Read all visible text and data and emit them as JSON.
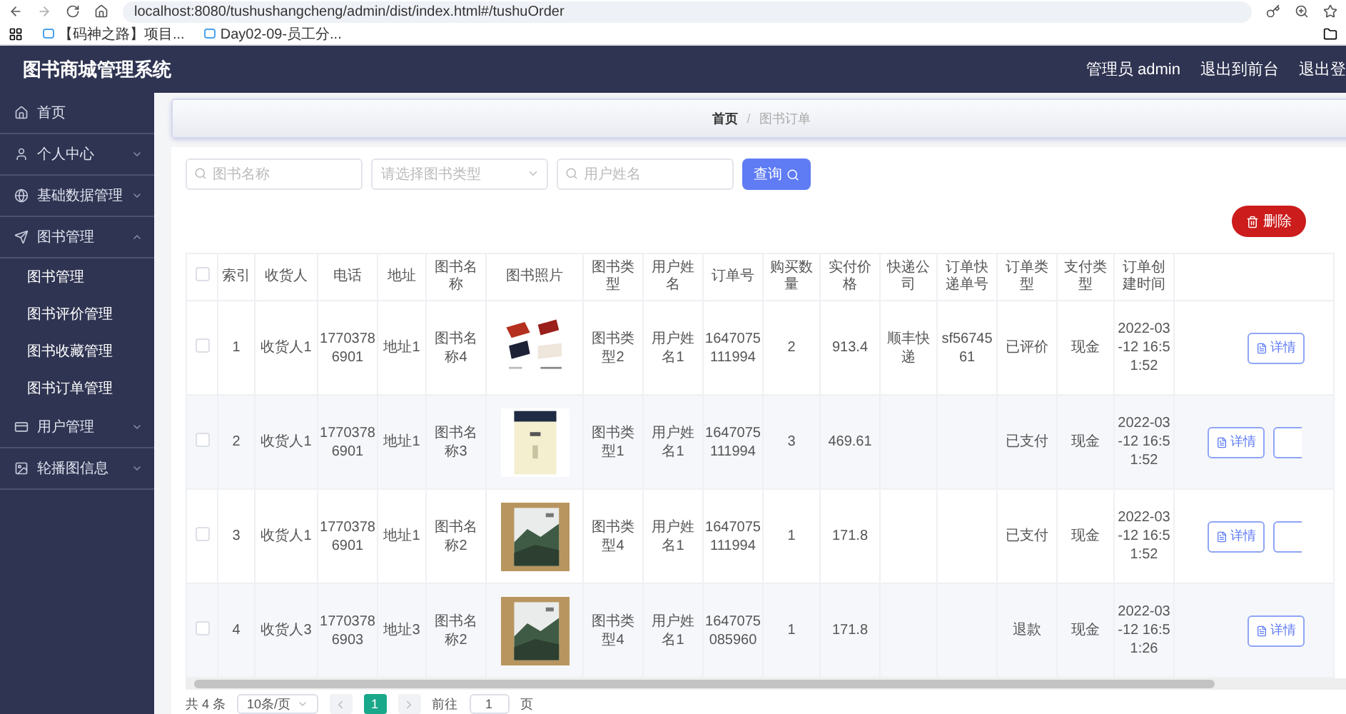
{
  "browser": {
    "url": "localhost:8080/tushushangcheng/admin/dist/index.html#/tushuOrder",
    "bookmarks": [
      "【码神之路】项目...",
      "Day02-09-员工分..."
    ]
  },
  "header": {
    "title": "图书商城管理系统",
    "user": "管理员 admin",
    "links": [
      "退出到前台",
      "退出登"
    ]
  },
  "sidebar": {
    "items": [
      {
        "label": "首页"
      },
      {
        "label": "个人中心",
        "expanded": false
      },
      {
        "label": "基础数据管理",
        "expanded": false
      },
      {
        "label": "图书管理",
        "expanded": true,
        "children": [
          {
            "label": "图书管理"
          },
          {
            "label": "图书评价管理"
          },
          {
            "label": "图书收藏管理"
          },
          {
            "label": "图书订单管理"
          }
        ]
      },
      {
        "label": "用户管理",
        "expanded": false
      },
      {
        "label": "轮播图信息",
        "expanded": false
      }
    ]
  },
  "breadcrumb": {
    "items": [
      "首页",
      "图书订单"
    ],
    "separator": "/"
  },
  "search": {
    "fields": [
      {
        "kind": "text",
        "placeholder": "图书名称"
      },
      {
        "kind": "select",
        "placeholder": "请选择图书类型"
      },
      {
        "kind": "text",
        "placeholder": "用户姓名"
      }
    ],
    "button": "查询"
  },
  "delete_button": "删除",
  "table": {
    "all_checked": false,
    "columns": [
      {
        "label": "索引",
        "kind": "text"
      },
      {
        "label": "收货人",
        "kind": "text"
      },
      {
        "label": "电话",
        "kind": "text"
      },
      {
        "label": "地址",
        "kind": "text"
      },
      {
        "label": "图书名称",
        "kind": "text"
      },
      {
        "label": "图书照片"
      },
      {
        "label": "图书类型",
        "kind": "text"
      },
      {
        "label": "用户姓名",
        "kind": "text"
      },
      {
        "label": "订单号",
        "kind": "text"
      },
      {
        "label": "购买数量",
        "kind": "text"
      },
      {
        "label": "实付价格",
        "kind": "text"
      },
      {
        "label": "快递公司",
        "kind": "text"
      },
      {
        "label": "订单快递单号",
        "kind": "text"
      },
      {
        "label": "订单类型",
        "kind": "text"
      },
      {
        "label": "支付类型",
        "kind": "text"
      },
      {
        "label": "订单创建时间",
        "kind": "text"
      }
    ],
    "rows": [
      {
        "checked": false,
        "cells": [
          "1",
          "收货人1",
          "17703786901",
          "地址1",
          "图书名称4",
          null,
          "图书类型2",
          "用户姓名1",
          "1647075111994",
          "2",
          "913.4",
          "顺丰快递",
          "sf5674561",
          "已评价",
          "现金",
          "2022-03-12 16:51:52"
        ],
        "photo": {
          "kind": "picture"
        },
        "actions": [
          {
            "kind": "details",
            "label": "详情"
          }
        ]
      },
      {
        "checked": false,
        "cells": [
          "2",
          "收货人1",
          "17703786901",
          "地址1",
          "图书名称3",
          null,
          "图书类型1",
          "用户姓名1",
          "1647075111994",
          "3",
          "469.61",
          null,
          null,
          "已支付",
          "现金",
          "2022-03-12 16:51:52"
        ],
        "photo": {
          "kind": "picture"
        },
        "actions": [
          {
            "kind": "details",
            "label": "详情"
          },
          {
            "kind": "cut"
          }
        ]
      },
      {
        "checked": false,
        "cells": [
          "3",
          "收货人1",
          "17703786901",
          "地址1",
          "图书名称2",
          null,
          "图书类型4",
          "用户姓名1",
          "1647075111994",
          "1",
          "171.8",
          null,
          null,
          "已支付",
          "现金",
          "2022-03-12 16:51:52"
        ],
        "photo": {
          "kind": "picture"
        },
        "actions": [
          {
            "kind": "details",
            "label": "详情"
          },
          {
            "kind": "cut"
          }
        ]
      },
      {
        "checked": false,
        "cells": [
          "4",
          "收货人3",
          "17703786903",
          "地址3",
          "图书名称2",
          null,
          "图书类型4",
          "用户姓名1",
          "1647075085960",
          "1",
          "171.8",
          null,
          null,
          "退款",
          "现金",
          "2022-03-12 16:51:26"
        ],
        "photo": {
          "kind": "picture"
        },
        "actions": [
          {
            "kind": "details",
            "label": "详情"
          }
        ]
      }
    ]
  },
  "pagination": {
    "total": "共 4 条",
    "page_size": "10条/页",
    "pages": [
      {
        "label": "1",
        "selected": true
      }
    ],
    "goto_label": "前往",
    "goto_value": "1",
    "goto_suffix": "页"
  }
}
